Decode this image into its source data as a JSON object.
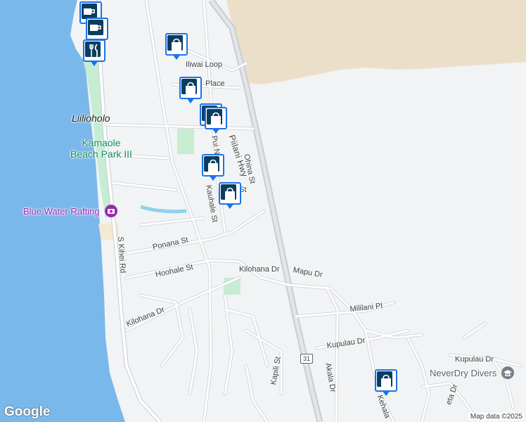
{
  "map": {
    "colors": {
      "water": "#7ab8ec",
      "land": "#f1f3f4",
      "upland": "#ecdfc9",
      "road": "#ffffff",
      "road_edge": "#c9cdd2",
      "park": "#c6ecd1",
      "highway": "#c8cdd3"
    },
    "streets": {
      "iliwai_loop": "Iliwai Loop",
      "place": "Place",
      "piilani_hwy": "Piilani Hwy",
      "pui_nani": "Pui N",
      "ohina": "Ohina St",
      "st_partial": "St",
      "kauhale": "Kauhale St",
      "ponana": "Ponana St",
      "hoohale": "Hoohale St",
      "s_kihei": "S Kihei Rd",
      "kilohana_dr_e": "Kilohana Dr",
      "kilohana_dr_w": "Kilohana Dr",
      "mapu": "Mapu Dr",
      "mililani": "Mililani Pl",
      "kupulau_w": "Kupulau Dr",
      "kupulau_e": "Kupulau Dr",
      "akala": "Akala Dr",
      "kapili": "Kapili St",
      "kehala": "Kehala",
      "eta": "eta Dr"
    },
    "places": {
      "liiholo": "Liilioholo"
    },
    "parks": {
      "kamaole_line1": "Kamaole",
      "kamaole_line2": "Beach Park III"
    },
    "pois": {
      "blue_water": "Blue Water Rafting",
      "neverdry": "NeverDry Divers"
    },
    "route_shield": "31",
    "markers": [
      {
        "icon": "cafe-icon"
      },
      {
        "icon": "cafe-icon"
      },
      {
        "icon": "restaurant-icon"
      },
      {
        "icon": "shopping-bag-icon"
      },
      {
        "icon": "shopping-bag-icon"
      },
      {
        "icon": "shopping-bag-icon"
      },
      {
        "icon": "shopping-bag-icon"
      },
      {
        "icon": "shopping-bag-icon"
      },
      {
        "icon": "shopping-bag-icon"
      }
    ],
    "logo": "Google",
    "attribution": "Map data ©2025"
  }
}
